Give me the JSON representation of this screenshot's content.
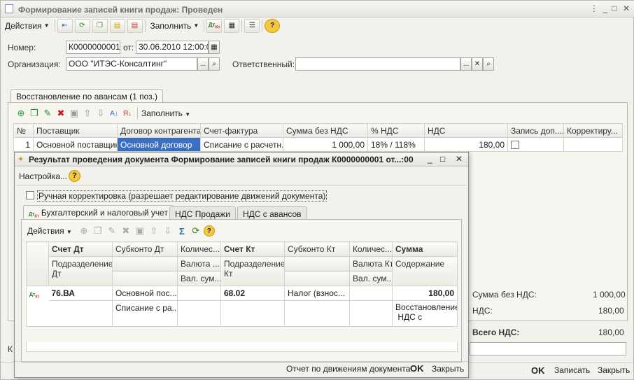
{
  "window": {
    "title": "Формирование записей книги продаж: Проведен"
  },
  "toolbar": {
    "actions": "Действия",
    "fill": "Заполнить"
  },
  "form": {
    "number_label": "Номер:",
    "number_value": "К0000000001",
    "date_label": "от:",
    "date_value": "30.06.2010 12:00:00",
    "org_label": "Организация:",
    "org_value": "ООО \"ИТЭС-Консалтинг\"",
    "resp_label": "Ответственный:",
    "resp_value": ""
  },
  "main_tab": {
    "label": "Восстановление по авансам (1 поз.)"
  },
  "grid_toolbar": {
    "fill": "Заполнить"
  },
  "grid": {
    "columns": [
      "№",
      "Поставщик",
      "Договор контрагента",
      "Счет-фактура",
      "Сумма без НДС",
      "% НДС",
      "НДС",
      "Запись доп....",
      "Корректиру..."
    ],
    "rows": [
      {
        "n": "1",
        "supplier": "Основной поставщик",
        "contract": "Основной договор",
        "invoice": "Списание с расчетн...",
        "sum": "1 000,00",
        "rate": "18% / 118%",
        "vat": "180,00"
      }
    ]
  },
  "totals": {
    "sum_label": "Сумма без НДС:",
    "sum_value": "1 000,00",
    "vat_label": "НДС:",
    "vat_value": "180,00",
    "total_label": "Всего НДС:",
    "total_value": "180,00"
  },
  "bottom": {
    "letter": "К",
    "ok": "OK",
    "save": "Записать",
    "close": "Закрыть"
  },
  "dialog": {
    "title": "Результат проведения документа Формирование записей книги продаж К0000000001 от...:00",
    "settings": "Настройка...",
    "manual": "Ручная корректировка (разрешает редактирование движений документа)",
    "tabs": [
      "Бухгалтерский и налоговый учет",
      "НДС Продажи",
      "НДС с авансов"
    ],
    "actions": "Действия",
    "headers": {
      "r1": [
        "Счет Дт",
        "Субконто Дт",
        "Количес...",
        "Счет Кт",
        "Субконто Кт",
        "Количес...",
        "Сумма"
      ],
      "r2": [
        "Подразделение Дт",
        "",
        "Валюта ...",
        "Подразделение Кт",
        "",
        "Валюта Кт",
        "Содержание"
      ],
      "r3": [
        "",
        "",
        "Вал. сум...",
        "",
        "",
        "Вал. сум...",
        ""
      ]
    },
    "row": {
      "dt": "76.ВА",
      "sub_dt1": "Основной пос...",
      "sub_dt2": "Списание с ра...",
      "kt": "68.02",
      "sub_kt": "Налог (взнос...",
      "sum": "180,00",
      "content1": "Восстановление",
      "content2": "НДС с"
    },
    "report": "Отчет по движениям документа",
    "ok": "OK",
    "close": "Закрыть"
  }
}
